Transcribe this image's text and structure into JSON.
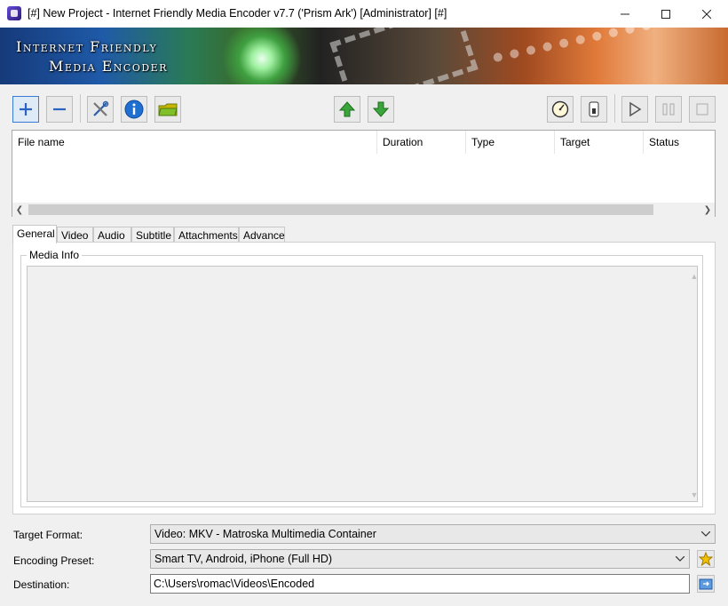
{
  "window": {
    "title": "[#] New Project - Internet Friendly Media Encoder v7.7 ('Prism Ark') [Administrator] [#]"
  },
  "banner": {
    "brand_line1": "Internet Friendly",
    "brand_line2": "Media Encoder"
  },
  "toolbar": {
    "icons": [
      "add-icon",
      "remove-icon",
      "tools-icon",
      "info-icon",
      "folder-icon",
      "move-up-icon",
      "move-down-icon",
      "gauge-icon",
      "toggle-icon",
      "play-icon",
      "pause-icon",
      "stop-icon"
    ]
  },
  "file_list": {
    "columns": [
      "File name",
      "Duration",
      "Type",
      "Target",
      "Status"
    ],
    "rows": []
  },
  "tabs": [
    "General",
    "Video",
    "Audio",
    "Subtitle",
    "Attachments",
    "Advance"
  ],
  "active_tab": "General",
  "media_info": {
    "legend": "Media Info",
    "content": ""
  },
  "target_format": {
    "label": "Target Format:",
    "value": "Video: MKV - Matroska Multimedia Container"
  },
  "encoding_preset": {
    "label": "Encoding Preset:",
    "value": "Smart TV, Android, iPhone (Full HD)"
  },
  "destination": {
    "label": "Destination:",
    "value": "C:\\Users\\romac\\Videos\\Encoded"
  },
  "colors": {
    "accent": "#3a7bd5",
    "green_arrow": "#3aa53a",
    "info_blue": "#1f6fd0",
    "star": "#f2c200"
  }
}
